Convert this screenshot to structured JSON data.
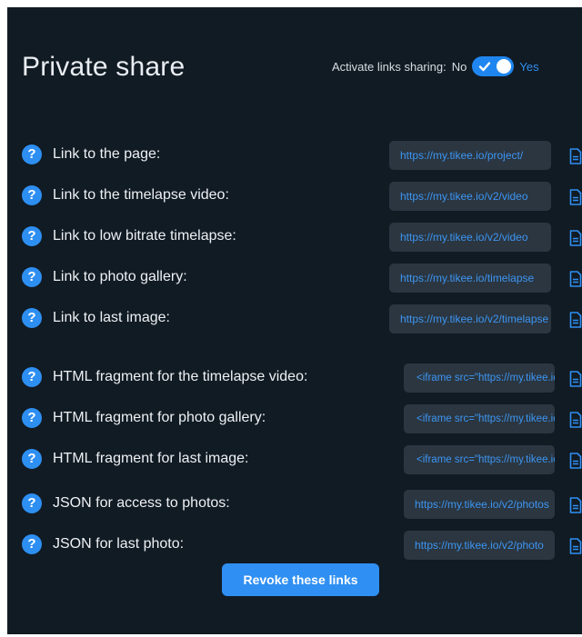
{
  "title": "Private share",
  "sharing": {
    "label": "Activate links sharing:",
    "off_label": "No",
    "on_label": "Yes",
    "enabled": true
  },
  "rows": [
    {
      "label": "Link to the page:",
      "value": "https://my.tikee.io/project/"
    },
    {
      "label": "Link to the timelapse video:",
      "value": "https://my.tikee.io/v2/video"
    },
    {
      "label": "Link to low bitrate timelapse:",
      "value": "https://my.tikee.io/v2/video"
    },
    {
      "label": "Link to photo gallery:",
      "value": "https://my.tikee.io/timelapse"
    },
    {
      "label": "Link to last image:",
      "value": "https://my.tikee.io/v2/timelapse"
    },
    {
      "label": "HTML fragment for the timelapse video:",
      "value": "<iframe src=\"https://my.tikee.io"
    },
    {
      "label": "HTML fragment for photo gallery:",
      "value": "<iframe src=\"https://my.tikee.io"
    },
    {
      "label": "HTML fragment for last image:",
      "value": "<iframe src=\"https://my.tikee.io"
    },
    {
      "label": "JSON for access to photos:",
      "value": "https://my.tikee.io/v2/photos"
    },
    {
      "label": "JSON for last photo:",
      "value": "https://my.tikee.io/v2/photo"
    }
  ],
  "help_glyph": "?",
  "icons": {
    "help": "question-circle-icon",
    "copy": "copy-document-icon",
    "toggle_check": "check-icon"
  },
  "colors": {
    "background": "#111b24",
    "accent": "#2f8ff2",
    "field": "#2b3640",
    "link_text": "#3d95f2"
  },
  "revoke_label": "Revoke these links"
}
